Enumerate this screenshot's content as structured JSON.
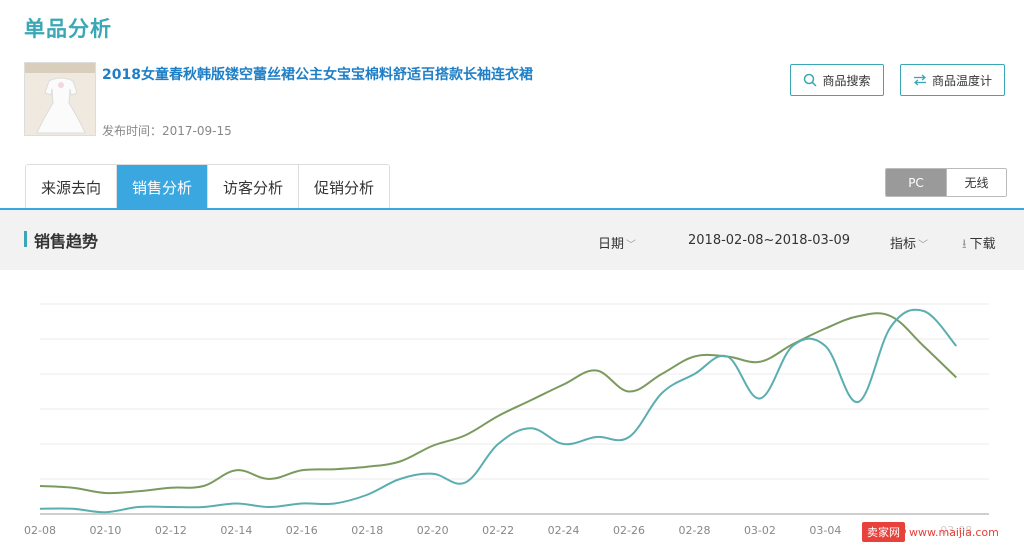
{
  "page": {
    "title": "单品分析"
  },
  "product": {
    "name": "2018女童春秋韩版镂空蕾丝裙公主女宝宝棉料舒适百搭款长袖连衣裙",
    "publish": "发布时间：2017-09-15"
  },
  "actions": {
    "search_label": "商品搜索",
    "temp_label": "商品温度计"
  },
  "tabs": [
    "来源去向",
    "销售分析",
    "访客分析",
    "促销分析"
  ],
  "active_tab": 1,
  "device": {
    "pc": "PC",
    "wireless": "无线",
    "selected": "PC"
  },
  "section": {
    "title": "销售趋势",
    "date_label": "日期",
    "date_range": "2018-02-08~2018-03-09",
    "metric_label": "指标",
    "download_label": "下载"
  },
  "watermark": {
    "logo": "卖家网",
    "url": "www.maijia.com"
  },
  "chart_data": {
    "type": "line",
    "x": [
      "02-08",
      "02-09",
      "02-10",
      "02-11",
      "02-12",
      "02-13",
      "02-14",
      "02-15",
      "02-16",
      "02-17",
      "02-18",
      "02-19",
      "02-20",
      "02-21",
      "02-22",
      "02-23",
      "02-24",
      "02-25",
      "02-26",
      "02-27",
      "02-28",
      "03-01",
      "03-02",
      "03-03",
      "03-04",
      "03-05",
      "03-06",
      "03-07",
      "03-08",
      "03-09"
    ],
    "tick_labels": [
      "02-08",
      "02-10",
      "02-12",
      "02-14",
      "02-16",
      "02-18",
      "02-20",
      "02-22",
      "02-24",
      "02-26",
      "02-28",
      "03-02",
      "03-04",
      "03-06",
      "03-08"
    ],
    "ylim": [
      0,
      6
    ],
    "y_axis_labels_shown": false,
    "grid": true,
    "series": [
      {
        "color": "#7a9a5e",
        "values": [
          0.8,
          0.75,
          0.6,
          0.65,
          0.75,
          0.8,
          1.25,
          1.0,
          1.25,
          1.28,
          1.35,
          1.5,
          1.95,
          2.25,
          2.8,
          3.25,
          3.7,
          4.1,
          3.5,
          4.0,
          4.5,
          4.5,
          4.35,
          4.85,
          5.3,
          5.65,
          5.65,
          4.8,
          3.9,
          null
        ]
      },
      {
        "color": "#5aaeb0",
        "values": [
          0.15,
          0.15,
          0.05,
          0.2,
          0.2,
          0.2,
          0.3,
          0.2,
          0.3,
          0.3,
          0.55,
          1.0,
          1.15,
          0.9,
          2.0,
          2.45,
          2.0,
          2.2,
          2.2,
          3.45,
          4.0,
          4.5,
          3.3,
          4.8,
          4.8,
          3.2,
          5.35,
          5.8,
          4.8,
          null
        ]
      }
    ]
  }
}
